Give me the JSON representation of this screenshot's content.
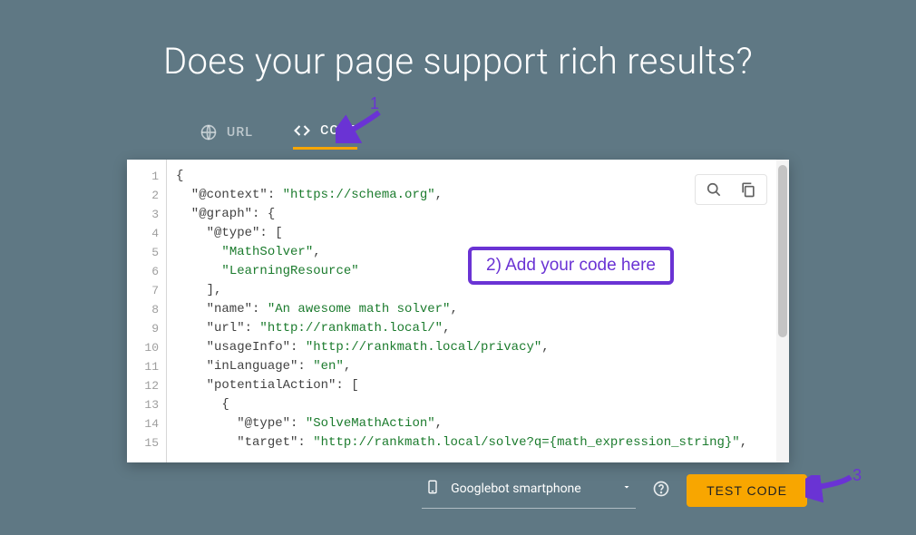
{
  "title": "Does your page support rich results?",
  "tabs": {
    "url_label": "URL",
    "code_label": "CODE"
  },
  "editor": {
    "line_numbers": [
      "1",
      "2",
      "3",
      "4",
      "5",
      "6",
      "7",
      "8",
      "9",
      "10",
      "11",
      "12",
      "13",
      "14",
      "15"
    ],
    "code_lines": [
      {
        "indent": 0,
        "plain": "{",
        "str": null
      },
      {
        "indent": 1,
        "plain": "\"@context\": ",
        "str": "\"https://schema.org\"",
        "tail": ","
      },
      {
        "indent": 1,
        "plain": "\"@graph\": {",
        "str": null
      },
      {
        "indent": 2,
        "plain": "\"@type\": [",
        "str": null
      },
      {
        "indent": 3,
        "plain": "",
        "str": "\"MathSolver\"",
        "tail": ","
      },
      {
        "indent": 3,
        "plain": "",
        "str": "\"LearningResource\""
      },
      {
        "indent": 2,
        "plain": "],",
        "str": null
      },
      {
        "indent": 2,
        "plain": "\"name\": ",
        "str": "\"An awesome math solver\"",
        "tail": ","
      },
      {
        "indent": 2,
        "plain": "\"url\": ",
        "str": "\"http://rankmath.local/\"",
        "tail": ","
      },
      {
        "indent": 2,
        "plain": "\"usageInfo\": ",
        "str": "\"http://rankmath.local/privacy\"",
        "tail": ","
      },
      {
        "indent": 2,
        "plain": "\"inLanguage\": ",
        "str": "\"en\"",
        "tail": ","
      },
      {
        "indent": 2,
        "plain": "\"potentialAction\": [",
        "str": null
      },
      {
        "indent": 3,
        "plain": "{",
        "str": null
      },
      {
        "indent": 4,
        "plain": "\"@type\": ",
        "str": "\"SolveMathAction\"",
        "tail": ","
      },
      {
        "indent": 4,
        "plain": "\"target\": ",
        "str": "\"http://rankmath.local/solve?q={math_expression_string}\"",
        "tail": ","
      }
    ]
  },
  "bottom": {
    "crawler_label": "Googlebot smartphone",
    "test_button": "TEST CODE"
  },
  "annotations": {
    "num1": "1",
    "num3": "3",
    "callout": "2) Add your code here"
  },
  "colors": {
    "accent": "#f8a600",
    "annotation": "#6a33d4"
  }
}
